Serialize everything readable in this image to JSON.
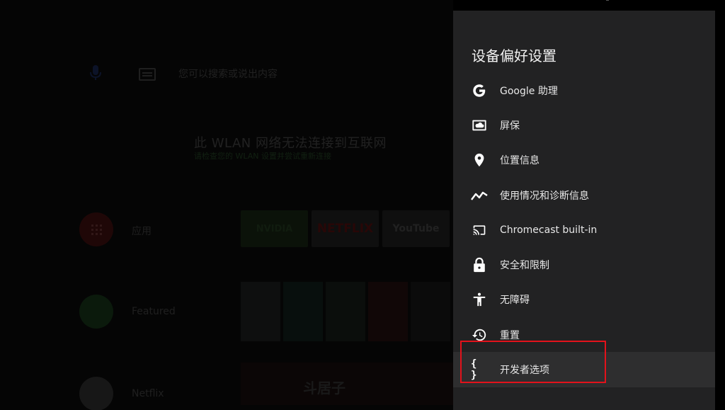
{
  "home": {
    "search_hint": "您可以搜索或说出内容",
    "wlan_title": "此 WLAN 网络无法连接到互联网",
    "wlan_subtitle": "请检查您的 WLAN 设置并尝试重新连接",
    "rows": [
      {
        "label": "应用"
      },
      {
        "label": "Featured"
      },
      {
        "label": "Netflix"
      }
    ],
    "tiles": {
      "nvidia": "NVIDIA",
      "netflix": "NETFLIX",
      "youtube": "YouTube"
    },
    "bottom_text": "斗居子"
  },
  "panel": {
    "title": "设备偏好设置",
    "items": [
      {
        "label": "Google 助理",
        "icon": "google-icon"
      },
      {
        "label": "屏保",
        "icon": "screensaver-icon"
      },
      {
        "label": "位置信息",
        "icon": "location-icon"
      },
      {
        "label": "使用情况和诊断信息",
        "icon": "usage-diagnostics-icon"
      },
      {
        "label": "Chromecast built-in",
        "icon": "cast-icon"
      },
      {
        "label": "安全和限制",
        "icon": "lock-icon"
      },
      {
        "label": "无障碍",
        "icon": "accessibility-icon"
      },
      {
        "label": "重置",
        "icon": "history-icon"
      },
      {
        "label": "开发者选项",
        "icon": "braces-icon",
        "focused": true
      }
    ]
  },
  "colors": {
    "panel_bg": "#222223",
    "highlight_border": "#e3121b"
  }
}
